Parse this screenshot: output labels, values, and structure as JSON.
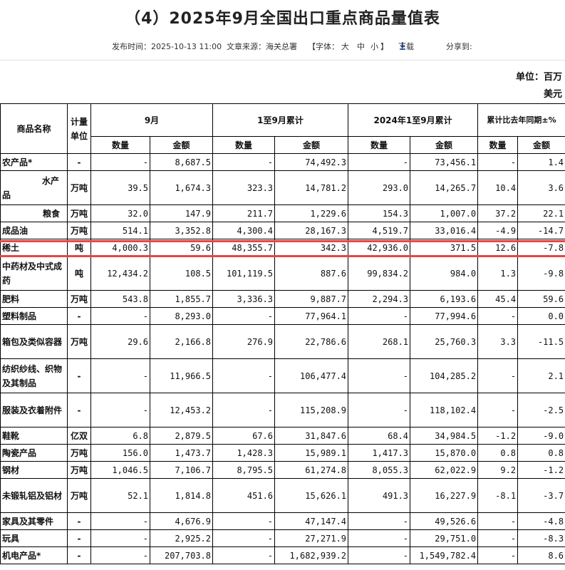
{
  "title": "（4）2025年9月全国出口重点商品量值表",
  "meta": {
    "published": "发布时间：2025-10-13 11:00",
    "source": "文章来源：海关总署",
    "font_label": "【字体：",
    "font_large": "大",
    "font_medium": "中",
    "font_small": "小",
    "font_close": "】",
    "download": "下载",
    "share": "分享到:"
  },
  "unit": "单位：百万美元",
  "headers": {
    "name": "商品名称",
    "unit": "计量单位",
    "sep": "9月",
    "ytd": "1至9月累计",
    "ytd_2024": "2024年1至9月累计",
    "yoy": "累计比去年同期±%",
    "qty": "数量",
    "amt": "金额"
  },
  "rows": [
    {
      "name": "农产品*",
      "unit": "-",
      "c": [
        "-",
        "8,687.5",
        "-",
        "74,492.3",
        "-",
        "73,456.1",
        "-",
        "1.4"
      ]
    },
    {
      "name": "水产品",
      "unit": "万吨",
      "c": [
        "39.5",
        "1,674.3",
        "323.3",
        "14,781.2",
        "293.0",
        "14,265.7",
        "10.4",
        "3.6"
      ]
    },
    {
      "name": "粮食",
      "unit": "万吨",
      "c": [
        "32.0",
        "147.9",
        "211.7",
        "1,229.6",
        "154.3",
        "1,007.0",
        "37.2",
        "22.1"
      ]
    },
    {
      "name": "成品油",
      "unit": "万吨",
      "c": [
        "514.1",
        "3,352.8",
        "4,300.4",
        "28,167.3",
        "4,519.7",
        "33,016.4",
        "-4.9",
        "-14.7"
      ]
    },
    {
      "name": "稀土",
      "unit": "吨",
      "c": [
        "4,000.3",
        "59.6",
        "48,355.7",
        "342.3",
        "42,936.0",
        "371.5",
        "12.6",
        "-7.8"
      ]
    },
    {
      "name": "中药材及中式成药",
      "unit": "吨",
      "c": [
        "12,434.2",
        "108.5",
        "101,119.5",
        "887.6",
        "99,834.2",
        "984.0",
        "1.3",
        "-9.8"
      ]
    },
    {
      "name": "肥料",
      "unit": "万吨",
      "c": [
        "543.8",
        "1,855.7",
        "3,336.3",
        "9,887.7",
        "2,294.3",
        "6,193.6",
        "45.4",
        "59.6"
      ]
    },
    {
      "name": "塑料制品",
      "unit": "-",
      "c": [
        "-",
        "8,293.0",
        "-",
        "77,964.1",
        "-",
        "77,994.6",
        "-",
        "0.0"
      ]
    },
    {
      "name": "箱包及类似容器",
      "unit": "万吨",
      "c": [
        "29.6",
        "2,166.8",
        "276.9",
        "22,786.6",
        "268.1",
        "25,760.3",
        "3.3",
        "-11.5"
      ]
    },
    {
      "name": "纺织纱线、织物及其制品",
      "unit": "-",
      "c": [
        "-",
        "11,966.5",
        "-",
        "106,477.4",
        "-",
        "104,285.2",
        "-",
        "2.1"
      ]
    },
    {
      "name": "服装及衣着附件",
      "unit": "-",
      "c": [
        "-",
        "12,453.2",
        "-",
        "115,208.9",
        "-",
        "118,102.4",
        "-",
        "-2.5"
      ]
    },
    {
      "name": "鞋靴",
      "unit": "亿双",
      "c": [
        "6.8",
        "2,879.5",
        "67.6",
        "31,847.6",
        "68.4",
        "34,984.5",
        "-1.2",
        "-9.0"
      ]
    },
    {
      "name": "陶瓷产品",
      "unit": "万吨",
      "c": [
        "156.0",
        "1,473.7",
        "1,428.3",
        "15,989.1",
        "1,417.3",
        "15,870.0",
        "0.8",
        "0.8"
      ]
    },
    {
      "name": "钢材",
      "unit": "万吨",
      "c": [
        "1,046.5",
        "7,106.7",
        "8,795.5",
        "61,274.8",
        "8,055.3",
        "62,022.9",
        "9.2",
        "-1.2"
      ]
    },
    {
      "name": "未锻轧铝及铝材",
      "unit": "万吨",
      "c": [
        "52.1",
        "1,814.8",
        "451.6",
        "15,626.1",
        "491.3",
        "16,227.9",
        "-8.1",
        "-3.7"
      ]
    },
    {
      "name": "家具及其零件",
      "unit": "-",
      "c": [
        "-",
        "4,676.9",
        "-",
        "47,147.4",
        "-",
        "49,526.6",
        "-",
        "-4.8"
      ]
    },
    {
      "name": "玩具",
      "unit": "-",
      "c": [
        "-",
        "2,925.2",
        "-",
        "27,271.9",
        "-",
        "29,751.0",
        "-",
        "-8.3"
      ]
    },
    {
      "name": "机电产品*",
      "unit": "-",
      "c": [
        "-",
        "207,703.8",
        "-",
        "1,682,939.2",
        "-",
        "1,549,782.4",
        "-",
        "8.6"
      ]
    }
  ]
}
